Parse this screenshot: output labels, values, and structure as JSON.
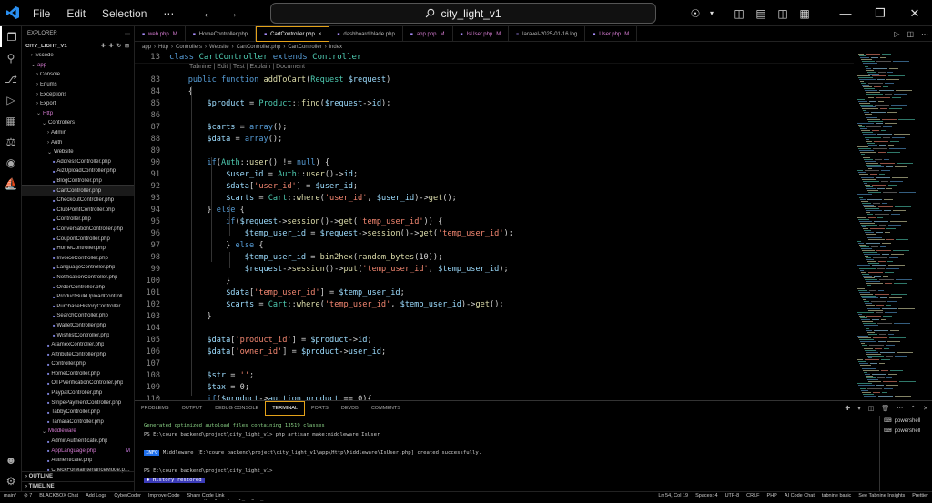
{
  "menu": [
    "File",
    "Edit",
    "Selection",
    "⋯"
  ],
  "search": {
    "text": "city_light_v1"
  },
  "explorer": {
    "title": "EXPLORER",
    "project": "CITY_LIGHT_V1",
    "items": [
      {
        "label": ".vscode",
        "depth": 1,
        "kind": "folder-closed"
      },
      {
        "label": "app",
        "depth": 1,
        "kind": "folder-open",
        "mod": true
      },
      {
        "label": "Console",
        "depth": 2,
        "kind": "folder-closed"
      },
      {
        "label": "Enums",
        "depth": 2,
        "kind": "folder-closed"
      },
      {
        "label": "Exceptions",
        "depth": 2,
        "kind": "folder-closed"
      },
      {
        "label": "Export",
        "depth": 2,
        "kind": "folder-closed"
      },
      {
        "label": "Http",
        "depth": 2,
        "kind": "folder-open",
        "mod": true
      },
      {
        "label": "Controllers",
        "depth": 3,
        "kind": "folder-open"
      },
      {
        "label": "Admin",
        "depth": 4,
        "kind": "folder-closed"
      },
      {
        "label": "Auth",
        "depth": 4,
        "kind": "folder-closed"
      },
      {
        "label": "Website",
        "depth": 4,
        "kind": "folder-open"
      },
      {
        "label": "AddressController.php",
        "depth": 5,
        "kind": "file"
      },
      {
        "label": "AizUploadController.php",
        "depth": 5,
        "kind": "file"
      },
      {
        "label": "BlogController.php",
        "depth": 5,
        "kind": "file"
      },
      {
        "label": "CartController.php",
        "depth": 5,
        "kind": "file",
        "selected": true
      },
      {
        "label": "CheckoutController.php",
        "depth": 5,
        "kind": "file"
      },
      {
        "label": "ClubPointController.php",
        "depth": 5,
        "kind": "file"
      },
      {
        "label": "Controller.php",
        "depth": 5,
        "kind": "file"
      },
      {
        "label": "ConversationController.php",
        "depth": 5,
        "kind": "file"
      },
      {
        "label": "CouponController.php",
        "depth": 5,
        "kind": "file"
      },
      {
        "label": "HomeController.php",
        "depth": 5,
        "kind": "file"
      },
      {
        "label": "InvoiceController.php",
        "depth": 5,
        "kind": "file"
      },
      {
        "label": "LanguageController.php",
        "depth": 5,
        "kind": "file"
      },
      {
        "label": "NotificationController.php",
        "depth": 5,
        "kind": "file"
      },
      {
        "label": "OrderController.php",
        "depth": 5,
        "kind": "file"
      },
      {
        "label": "ProductBulkUploadController.p...",
        "depth": 5,
        "kind": "file"
      },
      {
        "label": "PurchaseHistoryController.php",
        "depth": 5,
        "kind": "file"
      },
      {
        "label": "SearchController.php",
        "depth": 5,
        "kind": "file"
      },
      {
        "label": "WalletController.php",
        "depth": 5,
        "kind": "file"
      },
      {
        "label": "WishlistController.php",
        "depth": 5,
        "kind": "file"
      },
      {
        "label": "AramexController.php",
        "depth": 4,
        "kind": "file"
      },
      {
        "label": "AttributeController.php",
        "depth": 4,
        "kind": "file"
      },
      {
        "label": "Controller.php",
        "depth": 4,
        "kind": "file"
      },
      {
        "label": "HomeController.php",
        "depth": 4,
        "kind": "file"
      },
      {
        "label": "OTPVerificationController.php",
        "depth": 4,
        "kind": "file"
      },
      {
        "label": "PaypalController.php",
        "depth": 4,
        "kind": "file"
      },
      {
        "label": "StripePaymentController.php",
        "depth": 4,
        "kind": "file"
      },
      {
        "label": "TabbyController.php",
        "depth": 4,
        "kind": "file"
      },
      {
        "label": "TamaraController.php",
        "depth": 4,
        "kind": "file"
      },
      {
        "label": "Middleware",
        "depth": 3,
        "kind": "folder-open",
        "mod": true
      },
      {
        "label": "AdminAuthenticate.php",
        "depth": 4,
        "kind": "file"
      },
      {
        "label": "AppLanguage.php",
        "depth": 4,
        "kind": "file",
        "mod": true,
        "badge": "M"
      },
      {
        "label": "Authenticate.php",
        "depth": 4,
        "kind": "file"
      },
      {
        "label": "CheckForMaintenanceMode.php",
        "depth": 4,
        "kind": "file"
      }
    ],
    "outline": "OUTLINE",
    "timeline": "TIMELINE"
  },
  "tabs": [
    {
      "name": "web.php",
      "badge": "M",
      "mod": true
    },
    {
      "name": "HomeController.php",
      "badge": ""
    },
    {
      "name": "CartController.php",
      "badge": "×",
      "active": true
    },
    {
      "name": "dashboard.blade.php",
      "badge": ""
    },
    {
      "name": "app.php",
      "badge": "M",
      "mod": true
    },
    {
      "name": "IsUser.php",
      "badge": "M",
      "mod": true
    },
    {
      "name": "laravel-2025-01-16.log",
      "badge": ""
    },
    {
      "name": "User.php",
      "badge": "M",
      "mod": true
    }
  ],
  "breadcrumb": [
    "app",
    "Http",
    "Controllers",
    "Website",
    "CartController.php",
    "CartController",
    "index"
  ],
  "sticky": {
    "line": "13",
    "code": "class CartController extends Controller"
  },
  "hint": "Tabnine | Edit | Test | Explain | Document",
  "code": [
    {
      "n": "83",
      "t": "    public function addToCart(Request $request)"
    },
    {
      "n": "84",
      "t": "    {"
    },
    {
      "n": "85",
      "t": "        $product = Product::find($request->id);"
    },
    {
      "n": "86",
      "t": ""
    },
    {
      "n": "87",
      "t": "        $carts = array();"
    },
    {
      "n": "88",
      "t": "        $data = array();"
    },
    {
      "n": "89",
      "t": ""
    },
    {
      "n": "90",
      "t": "        if(Auth::user() != null) {"
    },
    {
      "n": "91",
      "t": "            $user_id = Auth::user()->id;"
    },
    {
      "n": "92",
      "t": "            $data['user_id'] = $user_id;"
    },
    {
      "n": "93",
      "t": "            $carts = Cart::where('user_id', $user_id)->get();"
    },
    {
      "n": "94",
      "t": "        } else {"
    },
    {
      "n": "95",
      "t": "            if($request->session()->get('temp_user_id')) {"
    },
    {
      "n": "96",
      "t": "                $temp_user_id = $request->session()->get('temp_user_id');"
    },
    {
      "n": "97",
      "t": "            } else {"
    },
    {
      "n": "98",
      "t": "                $temp_user_id = bin2hex(random_bytes(10));"
    },
    {
      "n": "99",
      "t": "                $request->session()->put('temp_user_id', $temp_user_id);"
    },
    {
      "n": "100",
      "t": "            }"
    },
    {
      "n": "101",
      "t": "            $data['temp_user_id'] = $temp_user_id;"
    },
    {
      "n": "102",
      "t": "            $carts = Cart::where('temp_user_id', $temp_user_id)->get();"
    },
    {
      "n": "103",
      "t": "        }"
    },
    {
      "n": "104",
      "t": ""
    },
    {
      "n": "105",
      "t": "        $data['product_id'] = $product->id;"
    },
    {
      "n": "106",
      "t": "        $data['owner_id'] = $product->user_id;"
    },
    {
      "n": "107",
      "t": ""
    },
    {
      "n": "108",
      "t": "        $str = '';"
    },
    {
      "n": "109",
      "t": "        $tax = 0;"
    },
    {
      "n": "110",
      "t": "        if($product->auction_product == 0){"
    }
  ],
  "panel": {
    "tabs": [
      "PROBLEMS",
      "OUTPUT",
      "DEBUG CONSOLE",
      "TERMINAL",
      "PORTS",
      "DEVDB",
      "COMMENTS"
    ],
    "active": "TERMINAL",
    "terminal": [
      {
        "cls": "g",
        "t": "Generated optimized autoload files containing 13519 classes"
      },
      {
        "t": "PS E:\\coure backend\\project\\city_light_v1> php artisan make:middleware IsUser"
      },
      {
        "t": ""
      },
      {
        "info": "INFO",
        "t": " Middleware [E:\\coure backend\\project\\city_light_v1\\app\\Http\\Middleware\\IsUser.php] created successfully."
      },
      {
        "t": ""
      },
      {
        "t": "PS E:\\coure backend\\project\\city_light_v1>"
      },
      {
        "restored": "History restored"
      },
      {
        "t": ""
      },
      {
        "t": "PS E:\\coure backend\\project\\city_light_v1>"
      }
    ],
    "terminals": [
      "powershell",
      "powershell"
    ]
  },
  "status": {
    "left": [
      "main*",
      "⊘ 7",
      "BLACKBOX Chat",
      "Add Logs",
      "CyberCoder",
      "Improve Code",
      "Share Code Link"
    ],
    "right": [
      "Ln 54, Col 19",
      "Spaces: 4",
      "UTF-8",
      "CRLF",
      "PHP",
      "AI Code Chat",
      "tabnine basic",
      "See Tabnine Insights",
      "Prettier"
    ]
  }
}
